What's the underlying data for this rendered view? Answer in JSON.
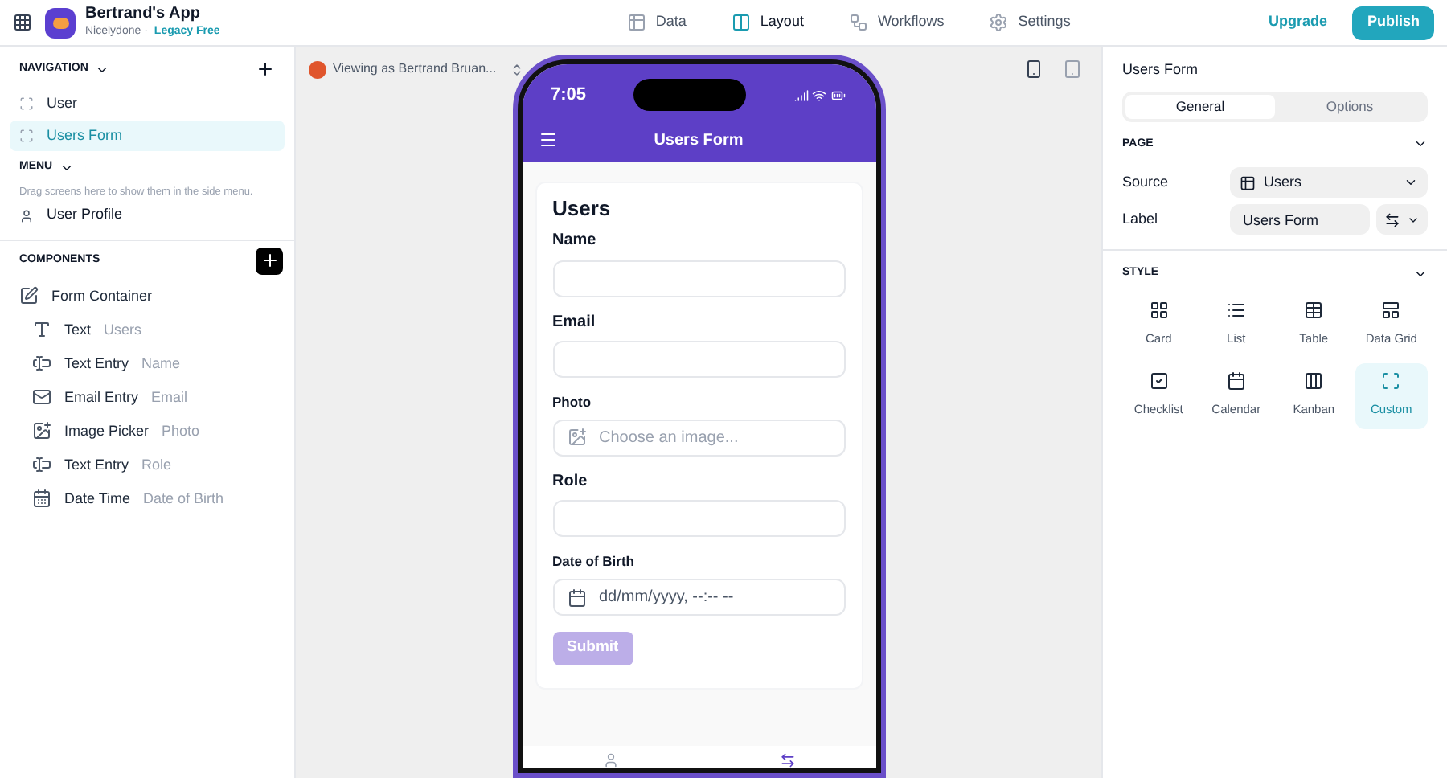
{
  "app": {
    "name": "Bertrand's App",
    "org": "Nicelydone ·",
    "plan": "Legacy Free"
  },
  "top_tabs": [
    {
      "label": "Data",
      "selected": false,
      "kind": "data"
    },
    {
      "label": "Layout",
      "selected": true,
      "kind": "layout"
    },
    {
      "label": "Workflows",
      "selected": false,
      "kind": "workflows"
    },
    {
      "label": "Settings",
      "selected": false,
      "kind": "settings"
    }
  ],
  "upgrade": "Upgrade",
  "publish": "Publish",
  "sidebar": {
    "navigation_title": "NAVIGATION",
    "navigation": [
      {
        "label": "User",
        "selected": false
      },
      {
        "label": "Users Form",
        "selected": true
      }
    ],
    "menu_title": "MENU",
    "menu_hint": "Drag screens here to show them in the side menu.",
    "menu_items": [
      {
        "label": "User Profile"
      }
    ],
    "components_title": "COMPONENTS",
    "components": [
      {
        "kind": "container",
        "name": "Form Container",
        "children": [
          {
            "kind": "text",
            "name": "Text",
            "detail": "Users"
          },
          {
            "kind": "entry",
            "name": "Text Entry",
            "detail": "Name"
          },
          {
            "kind": "email",
            "name": "Email Entry",
            "detail": "Email"
          },
          {
            "kind": "image",
            "name": "Image Picker",
            "detail": "Photo"
          },
          {
            "kind": "entry",
            "name": "Text Entry",
            "detail": "Role"
          },
          {
            "kind": "date",
            "name": "Date Time",
            "detail": "Date of Birth"
          }
        ]
      }
    ]
  },
  "viewer": "Viewing as Bertrand Bruan...",
  "phone": {
    "time": "7:05",
    "title": "Users Form",
    "form_title": "Users",
    "fields": [
      {
        "kind": "text",
        "label": "Name"
      },
      {
        "kind": "text",
        "label": "Email"
      },
      {
        "kind": "image",
        "label": "Photo",
        "placeholder": "Choose an image..."
      },
      {
        "kind": "text",
        "label": "Role"
      },
      {
        "kind": "date",
        "label": "Date of Birth",
        "placeholder": "dd/mm/yyyy, --:-- --"
      }
    ],
    "submit": {
      "label": "Submit",
      "disabled": true
    },
    "bottom_tabs": [
      {
        "kind": "person",
        "selected": false
      },
      {
        "kind": "arrows",
        "selected": true
      }
    ]
  },
  "panel": {
    "title": "Users Form",
    "tabs": [
      {
        "label": "General",
        "selected": true
      },
      {
        "label": "Options",
        "selected": false
      }
    ],
    "page_title": "PAGE",
    "source_label": "Source",
    "source_value": "Users",
    "label_label": "Label",
    "label_value": "Users Form",
    "style_title": "STYLE",
    "styles": [
      {
        "kind": "card",
        "label": "Card",
        "selected": false
      },
      {
        "kind": "list",
        "label": "List",
        "selected": false
      },
      {
        "kind": "table",
        "label": "Table",
        "selected": false
      },
      {
        "kind": "grid",
        "label": "Data Grid",
        "selected": false
      },
      {
        "kind": "checklist",
        "label": "Checklist",
        "selected": false
      },
      {
        "kind": "calendar",
        "label": "Calendar",
        "selected": false
      },
      {
        "kind": "kanban",
        "label": "Kanban",
        "selected": false
      },
      {
        "kind": "custom",
        "label": "Custom",
        "selected": true
      }
    ]
  }
}
